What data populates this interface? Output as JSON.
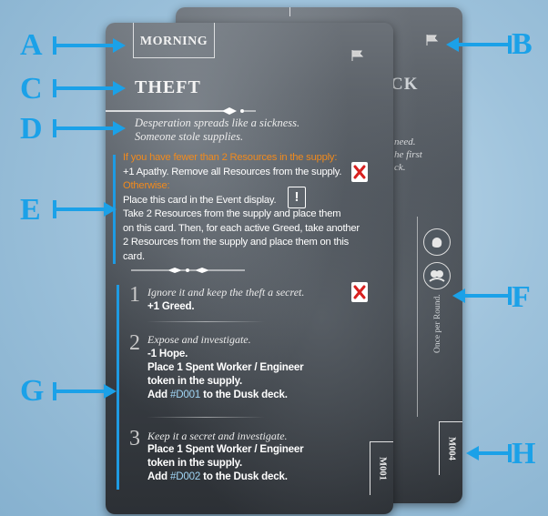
{
  "back_card": {
    "title_partial": "CK",
    "text_line1": "need.",
    "text_line2": "he first",
    "text_line3": "ck.",
    "once_per_round": "Once per Round.",
    "card_id": "M004"
  },
  "front_card": {
    "time_of_day": "MORNING",
    "title": "THEFT",
    "flavor_line1": "Desperation spreads like a sickness.",
    "flavor_line2": "Someone stole supplies.",
    "condition_1": "If you have fewer than 2 Resources in the supply:",
    "effect_1": "+1 Apathy. Remove all Resources from the supply.",
    "condition_2": "Otherwise:",
    "effect_2_line1": "Place this card in the Event display.",
    "effect_2_line2": "Take 2 Resources from the supply and place them",
    "effect_2_line3": "on this card. Then, for each active Greed, take another",
    "effect_2_line4": "2 Resources from the supply and place them on this card.",
    "options": [
      {
        "number": "1",
        "italic": "Ignore it and keep the theft a secret.",
        "line1": "+1 Greed."
      },
      {
        "number": "2",
        "italic": "Expose and investigate.",
        "line1": "-1 Hope.",
        "line2": "Place 1 Spent Worker / Engineer",
        "line3": "token in the supply.",
        "line4_pre": "Add ",
        "line4_code": "#D001",
        "line4_post": " to the Dusk deck."
      },
      {
        "number": "3",
        "italic": "Keep it a secret and investigate.",
        "line1": "Place 1 Spent Worker / Engineer",
        "line2": "token in the supply.",
        "line3_pre": "Add ",
        "line3_code": "#D002",
        "line3_post": " to the Dusk deck."
      }
    ],
    "card_id": "M001"
  },
  "callouts": [
    "A",
    "B",
    "C",
    "D",
    "E",
    "F",
    "G",
    "H"
  ],
  "colors": {
    "callout_blue": "#1ba1e8",
    "orange_text": "#f18a1d",
    "bar_blue": "#1e9be3"
  }
}
